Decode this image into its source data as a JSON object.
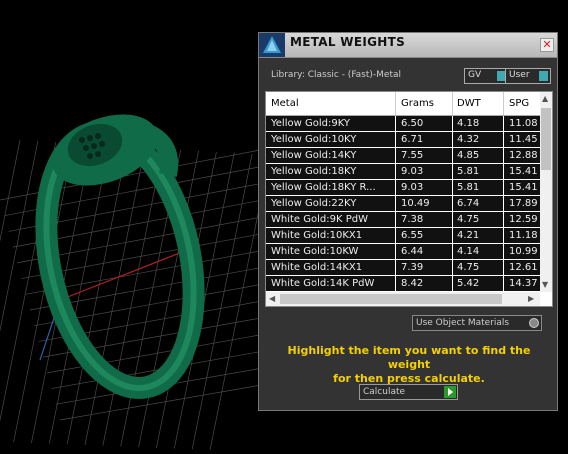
{
  "panel": {
    "title": "METAL WEIGHTS",
    "close_label": "✕",
    "library_label": "Library: Classic - (Fast)-Metal",
    "gv_label": "GV",
    "user_label": "User",
    "columns": [
      "Metal",
      "Grams",
      "DWT",
      "SPG"
    ],
    "rows": [
      [
        "Yellow Gold:9KY",
        "6.50",
        "4.18",
        "11.08"
      ],
      [
        "Yellow Gold:10KY",
        "6.71",
        "4.32",
        "11.45"
      ],
      [
        "Yellow Gold:14KY",
        "7.55",
        "4.85",
        "12.88"
      ],
      [
        "Yellow Gold:18KY",
        "9.03",
        "5.81",
        "15.41"
      ],
      [
        "Yellow Gold:18KY R...",
        "9.03",
        "5.81",
        "15.41"
      ],
      [
        "Yellow Gold:22KY",
        "10.49",
        "6.74",
        "17.89"
      ],
      [
        "White Gold:9K PdW",
        "7.38",
        "4.75",
        "12.59"
      ],
      [
        "White Gold:10KX1",
        "6.55",
        "4.21",
        "11.18"
      ],
      [
        "White Gold:10KW",
        "6.44",
        "4.14",
        "10.99"
      ],
      [
        "White Gold:14KX1",
        "7.39",
        "4.75",
        "12.61"
      ],
      [
        "White Gold:14K PdW",
        "8.42",
        "5.42",
        "14.37"
      ]
    ],
    "material_dropdown": "Use Object Materials",
    "instruction_line1": "Highlight the item you want to find the weight",
    "instruction_line2": "for then press calculate.",
    "calculate_label": "Calculate"
  },
  "colors": {
    "ring": "#0f6b48",
    "instruction": "#f6d000",
    "accent": "#3fa8b0"
  }
}
